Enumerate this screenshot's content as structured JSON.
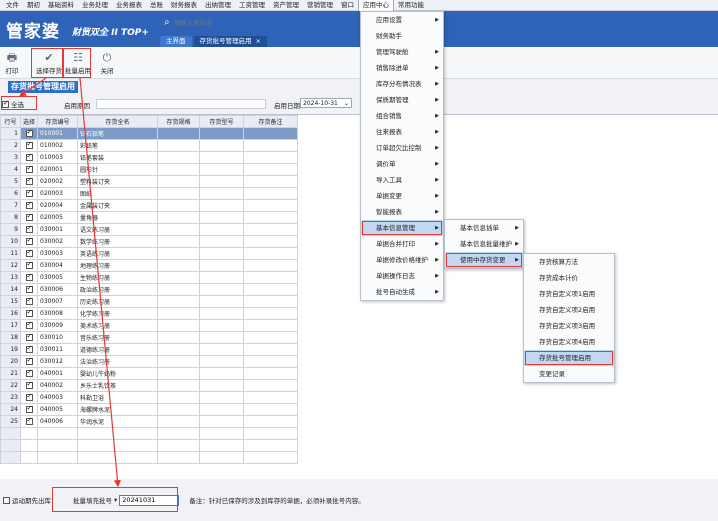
{
  "menubar": [
    "文件",
    "期初",
    "基础资料",
    "业务处理",
    "业务报表",
    "总账",
    "财务报表",
    "出纳管理",
    "工资管理",
    "资产管理",
    "营销管理",
    "窗口",
    "应用中心",
    "常用功能"
  ],
  "header": {
    "logo": "管家婆",
    "logo_sub": "财贸双全 II TOP+",
    "search_placeholder": "请输入菜单名",
    "tab_home": "主界面",
    "tab_current": "存货批号管理启用",
    "tab_close": "×"
  },
  "toolbar": {
    "print": "打印",
    "select_inventory": "选择存货",
    "batch_enable": "批量启用",
    "close": "关闭"
  },
  "page_title": "存货批号管理启用",
  "filter": {
    "select_all": "全选",
    "enable_reason_label": "启用原因",
    "enable_date_label": "启用日期",
    "enable_date": "2024-10-31"
  },
  "grid": {
    "headers": [
      "行号",
      "选择",
      "存货编号",
      "存货全名",
      "存货规格",
      "存货型号",
      "存货备注"
    ],
    "rows": [
      {
        "no": "1",
        "code": "010001",
        "name": "钻石铅笔"
      },
      {
        "no": "2",
        "code": "010002",
        "name": "彩铅笔"
      },
      {
        "no": "3",
        "code": "010003",
        "name": "铅笔套装"
      },
      {
        "no": "4",
        "code": "020001",
        "name": "圆形针"
      },
      {
        "no": "5",
        "code": "020002",
        "name": "塑料装订夹"
      },
      {
        "no": "6",
        "code": "020003",
        "name": "图纸"
      },
      {
        "no": "7",
        "code": "020004",
        "name": "金属装订夹"
      },
      {
        "no": "8",
        "code": "020005",
        "name": "量角器"
      },
      {
        "no": "9",
        "code": "030001",
        "name": "语文练习册"
      },
      {
        "no": "10",
        "code": "030002",
        "name": "数学练习册"
      },
      {
        "no": "11",
        "code": "030003",
        "name": "英语练习册"
      },
      {
        "no": "12",
        "code": "030004",
        "name": "地理练习册"
      },
      {
        "no": "13",
        "code": "030005",
        "name": "生物练习册"
      },
      {
        "no": "14",
        "code": "030006",
        "name": "政治练习册"
      },
      {
        "no": "15",
        "code": "030007",
        "name": "历史练习册"
      },
      {
        "no": "16",
        "code": "030008",
        "name": "化学练习册"
      },
      {
        "no": "17",
        "code": "030009",
        "name": "美术练习册"
      },
      {
        "no": "18",
        "code": "030010",
        "name": "音乐练习册"
      },
      {
        "no": "19",
        "code": "030011",
        "name": "道德练习册"
      },
      {
        "no": "20",
        "code": "030012",
        "name": "法治练习册"
      },
      {
        "no": "21",
        "code": "040001",
        "name": "婴幼儿牛奶粉"
      },
      {
        "no": "22",
        "code": "040002",
        "name": "乡乐士乳饮茶"
      },
      {
        "no": "23",
        "code": "040003",
        "name": "科勒卫浴"
      },
      {
        "no": "24",
        "code": "040005",
        "name": "海螺牌水泥"
      },
      {
        "no": "25",
        "code": "040006",
        "name": "华润水泥"
      }
    ]
  },
  "footer": {
    "auto_fifo": "运动期先出库",
    "batch_fill_label": "批量填充批号",
    "batch_value": "20241031",
    "note": "备注：针对已保存的涉及到库存的单据，必须补录批号内容。"
  },
  "menu1": [
    {
      "label": "应用设置",
      "arrow": "▶"
    },
    {
      "label": "财务助手",
      "arrow": ""
    },
    {
      "label": "管理驾驶舱",
      "arrow": "▶"
    },
    {
      "label": "销售除进单",
      "arrow": "▶"
    },
    {
      "label": "库存分布情况表",
      "arrow": "▶"
    },
    {
      "label": "保质期管理",
      "arrow": "▶"
    },
    {
      "label": "组合销售",
      "arrow": "▶"
    },
    {
      "label": "往来报表",
      "arrow": "▶"
    },
    {
      "label": "订单超欠比控制",
      "arrow": "▶"
    },
    {
      "label": "调价单",
      "arrow": "▶"
    },
    {
      "label": "导入工具",
      "arrow": "▶"
    },
    {
      "label": "单据变更",
      "arrow": "▶"
    },
    {
      "label": "智能报表",
      "arrow": "▶"
    },
    {
      "label": "基本信息管理",
      "arrow": "▶"
    },
    {
      "label": "单据合并打印",
      "arrow": "▶"
    },
    {
      "label": "单据修改价格维护",
      "arrow": "▶"
    },
    {
      "label": "单据操作日志",
      "arrow": "▶"
    },
    {
      "label": "批号自动生成",
      "arrow": "▶"
    }
  ],
  "menu2": [
    {
      "label": "基本信息插单",
      "arrow": "▶"
    },
    {
      "label": "基本信息批量维护",
      "arrow": "▶"
    },
    {
      "label": "使用中存货变更",
      "arrow": "▶"
    }
  ],
  "menu3": [
    {
      "label": "存货核算方法"
    },
    {
      "label": "存货成本计价"
    },
    {
      "label": "存货自定义项1启用"
    },
    {
      "label": "存货自定义项2启用"
    },
    {
      "label": "存货自定义项3启用"
    },
    {
      "label": "存货自定义项4启用"
    },
    {
      "label": "存货批号管理启用"
    },
    {
      "label": "变更记录"
    }
  ],
  "colors": {
    "header": "#2e63b8",
    "accent": "#e53935",
    "selected_row": "#7d9bc4"
  }
}
